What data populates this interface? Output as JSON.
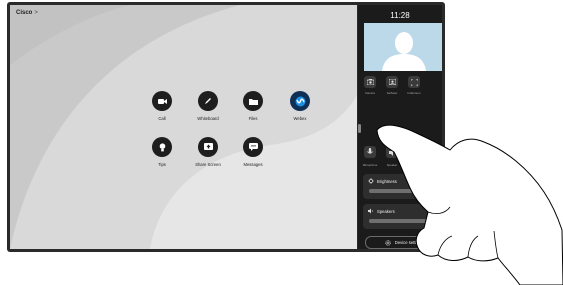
{
  "brand": {
    "name": "Cisco",
    "chevron": ">"
  },
  "apps": {
    "call": "Call",
    "whiteboard": "Whiteboard",
    "files": "Files",
    "webex": "Webex",
    "tips": "Tips",
    "share_screen": "Share Screen",
    "messages": "Messages"
  },
  "control_panel": {
    "time": "11:28",
    "quick_buttons": [
      "Camera",
      "Selfview",
      "Fullscreen"
    ],
    "media_buttons": [
      "Microphone",
      "Speaker"
    ],
    "brightness": {
      "label": "Brightness",
      "level": 0.88
    },
    "speakers": {
      "label": "Speakers",
      "level": 0.9
    },
    "device_settings": "Device settings"
  },
  "colors": {
    "panel_bg": "#1b1b1b",
    "home_bg": "#cfcfcf",
    "webex_blue": "#0f2f56",
    "selfview_bg": "#b9d8ea"
  },
  "icons": [
    "camera-icon",
    "whiteboard-pen-icon",
    "folder-icon",
    "webex-icon",
    "lightbulb-icon",
    "share-screen-icon",
    "message-icon",
    "gear-icon",
    "sun-icon",
    "speaker-icon",
    "microphone-icon"
  ]
}
